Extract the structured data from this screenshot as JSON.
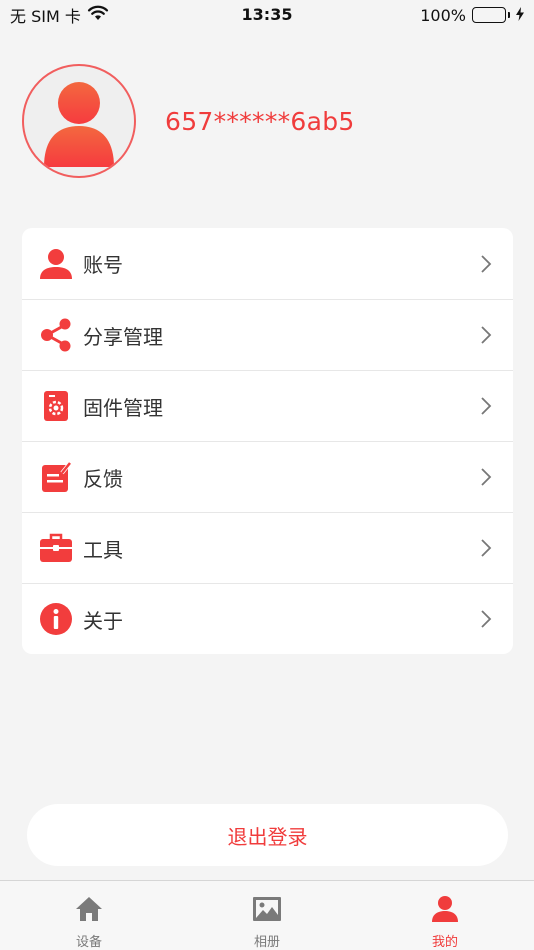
{
  "status_bar": {
    "carrier": "无 SIM 卡",
    "time": "13:35",
    "battery": "100%"
  },
  "profile": {
    "username": "657******6ab5",
    "avatar_icon": "user-avatar-icon"
  },
  "menu": {
    "items": [
      {
        "label": "账号",
        "icon": "user-icon"
      },
      {
        "label": "分享管理",
        "icon": "share-icon"
      },
      {
        "label": "固件管理",
        "icon": "firmware-icon"
      },
      {
        "label": "反馈",
        "icon": "feedback-icon"
      },
      {
        "label": "工具",
        "icon": "toolbox-icon"
      },
      {
        "label": "关于",
        "icon": "info-icon"
      }
    ]
  },
  "logout": {
    "label": "退出登录"
  },
  "tab_bar": {
    "tabs": [
      {
        "label": "设备",
        "icon": "home-icon",
        "active": false
      },
      {
        "label": "相册",
        "icon": "photo-icon",
        "active": false
      },
      {
        "label": "我的",
        "icon": "user-icon",
        "active": true
      }
    ]
  },
  "colors": {
    "accent": "#f03c3c",
    "icon_red": "#f23d3d",
    "inactive": "#7a7a7a",
    "battery": "#35c759"
  }
}
